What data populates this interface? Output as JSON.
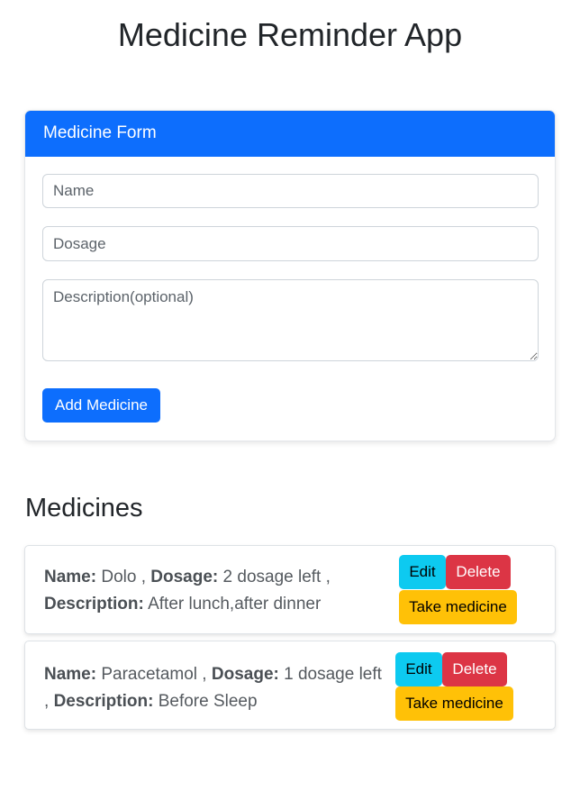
{
  "app": {
    "title": "Medicine Reminder App"
  },
  "form": {
    "header": "Medicine Form",
    "name_placeholder": "Name",
    "dosage_placeholder": "Dosage",
    "description_placeholder": "Description(optional)",
    "submit_label": "Add Medicine"
  },
  "medicines": {
    "title": "Medicines",
    "labels": {
      "name": "Name:",
      "dosage": "Dosage:",
      "description": "Description:"
    },
    "items": [
      {
        "name": "Dolo",
        "dosage": "2 dosage left",
        "description": "After lunch,after dinner"
      },
      {
        "name": "Paracetamol",
        "dosage": "1 dosage left",
        "description": "Before Sleep"
      }
    ],
    "actions": {
      "edit": "Edit",
      "delete": "Delete",
      "take": "Take medicine"
    }
  },
  "colors": {
    "primary": "#0d6efd",
    "info": "#0dcaf0",
    "danger": "#dc3545",
    "warning": "#ffc107"
  }
}
